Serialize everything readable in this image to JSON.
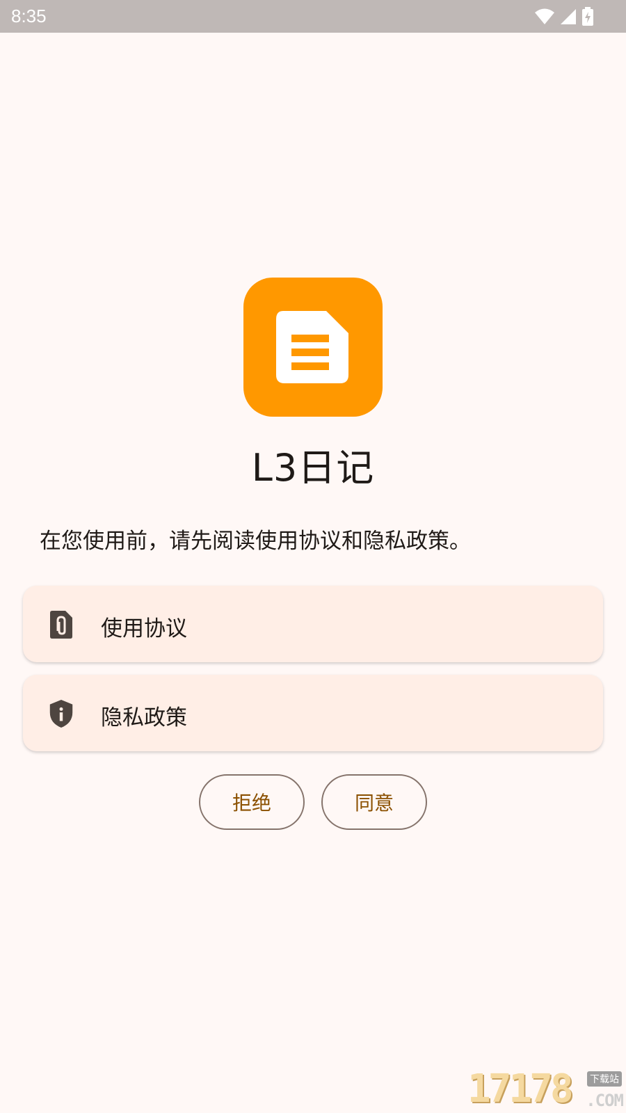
{
  "status_bar": {
    "time": "8:35",
    "icons": [
      "wifi-icon",
      "signal-icon",
      "battery-charging-icon"
    ]
  },
  "app": {
    "icon": "document-icon",
    "icon_color": "#ff9800",
    "name": "L3日记"
  },
  "intro": "在您使用前，请先阅读使用协议和隐私政策。",
  "links": [
    {
      "icon": "attachment-file-icon",
      "label": "使用协议"
    },
    {
      "icon": "shield-info-icon",
      "label": "隐私政策"
    }
  ],
  "buttons": {
    "reject": "拒绝",
    "agree": "同意"
  },
  "watermark": {
    "main": "17178",
    "tag": "下载站",
    "domain": ".COM"
  },
  "colors": {
    "background": "#fff8f6",
    "card": "#ffeee6",
    "button_text": "#8b5000",
    "accent": "#ff9800"
  }
}
